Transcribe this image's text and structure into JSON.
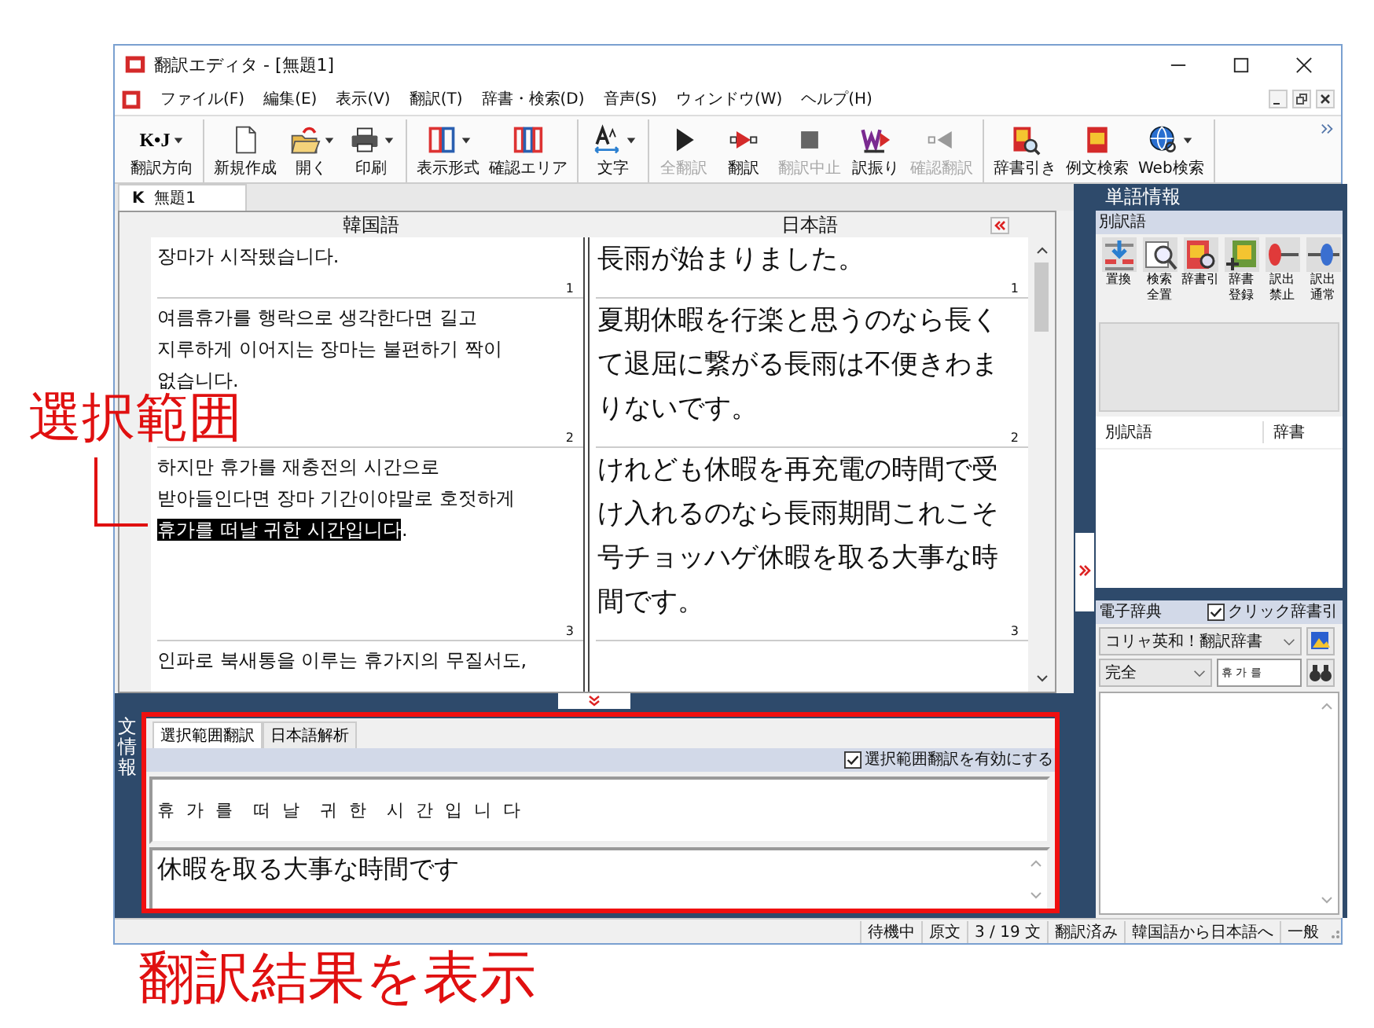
{
  "window": {
    "title": "翻訳エディタ - [無題1]"
  },
  "menu": [
    "ファイル(F)",
    "編集(E)",
    "表示(V)",
    "翻訳(T)",
    "辞書・検索(D)",
    "音声(S)",
    "ウィンドウ(W)",
    "ヘルプ(H)"
  ],
  "toolbar": [
    {
      "items": [
        {
          "kind": "direction",
          "glyph": "K•J",
          "label": "翻訳方向",
          "dropdown": true,
          "disabled": false
        }
      ]
    },
    {
      "items": [
        {
          "kind": "new",
          "label": "新規作成",
          "dropdown": false,
          "disabled": false
        },
        {
          "kind": "open",
          "label": "開く",
          "dropdown": true,
          "disabled": false
        },
        {
          "kind": "print",
          "label": "印刷",
          "dropdown": true,
          "disabled": false
        }
      ]
    },
    {
      "items": [
        {
          "kind": "layout",
          "label": "表示形式",
          "dropdown": true,
          "disabled": false
        },
        {
          "kind": "confirm_area",
          "label": "確認エリア",
          "dropdown": false,
          "disabled": false
        }
      ]
    },
    {
      "items": [
        {
          "kind": "font",
          "label": "文字",
          "dropdown": true,
          "disabled": false
        }
      ]
    },
    {
      "items": [
        {
          "kind": "translate_all",
          "label": "全翻訳",
          "dropdown": false,
          "disabled": true
        },
        {
          "kind": "translate",
          "label": "翻訳",
          "dropdown": false,
          "disabled": false
        },
        {
          "kind": "stop",
          "label": "翻訳中止",
          "dropdown": false,
          "disabled": true
        },
        {
          "kind": "word",
          "label": "訳振り",
          "dropdown": false,
          "disabled": false
        },
        {
          "kind": "check",
          "label": "確認翻訳",
          "dropdown": false,
          "disabled": true
        }
      ]
    },
    {
      "items": [
        {
          "kind": "dict",
          "label": "辞書引き",
          "dropdown": false,
          "disabled": false
        },
        {
          "kind": "example",
          "label": "例文検索",
          "dropdown": false,
          "disabled": false
        },
        {
          "kind": "web",
          "label": "Web検索",
          "dropdown": true,
          "disabled": false
        }
      ]
    }
  ],
  "document_tab": {
    "glyph": "K",
    "label": "無題1"
  },
  "editor": {
    "source_heading": "韓国語",
    "target_heading": "日本語",
    "segments": [
      {
        "source_number": "1",
        "target_number": "1",
        "source_lines": [
          [
            {
              "text": "장마가 시작됐습니다.",
              "selected": false
            }
          ]
        ],
        "target": "長雨が始まりました。"
      },
      {
        "source_number": "2",
        "target_number": "2",
        "source_lines": [
          [
            {
              "text": "여름휴가를 행락으로 생각한다면 길고",
              "selected": false
            }
          ],
          [
            {
              "text": "지루하게 이어지는 장마는 불편하기 짝이",
              "selected": false
            }
          ],
          [
            {
              "text": "없습니다.",
              "selected": false
            }
          ]
        ],
        "target": "夏期休暇を行楽と思うのなら長くて退屈に繋がる長雨は不便きわまりないです。"
      },
      {
        "source_number": "3",
        "target_number": "3",
        "source_lines": [
          [
            {
              "text": "하지만 휴가를 재충전의 시간으로",
              "selected": false
            }
          ],
          [
            {
              "text": "받아들인다면 장마 기간이야말로 호젓하게",
              "selected": false
            }
          ],
          [
            {
              "text": "휴가를 떠날 귀한 시간입니다",
              "selected": true
            },
            {
              "text": ".",
              "selected": false
            }
          ]
        ],
        "target": "けれども休暇を再充電の時間で受け入れるのなら長雨期間これこそ号チョッハゲ休暇を取る大事な時間です。"
      },
      {
        "source_lines": [
          [
            {
              "text": "인파로 북새통을 이루는 휴가지의 무질서도,",
              "selected": false
            }
          ]
        ]
      }
    ]
  },
  "sentence_panel": {
    "side_label": "文情報",
    "tabs": [
      {
        "label": "選択範囲翻訳",
        "selected": true
      },
      {
        "label": "日本語解析",
        "selected": false
      }
    ],
    "enable_option": {
      "label": "選択範囲翻訳を有効にする",
      "checked": true
    },
    "source": "휴 가 를  떠 날  귀 한  시 간 입 니 다",
    "result": "休暇を取る大事な時間です"
  },
  "word_info": {
    "title": "単語情報",
    "section": "別訳語",
    "tools": [
      {
        "kind": "replace",
        "label_lines": [
          "置換"
        ]
      },
      {
        "kind": "search_all",
        "label_lines": [
          "検索",
          "全置"
        ]
      },
      {
        "kind": "lookup",
        "label_lines": [
          "辞書引"
        ]
      },
      {
        "kind": "register",
        "label_lines": [
          "辞書",
          "登録"
        ]
      },
      {
        "kind": "block",
        "label_lines": [
          "訳出",
          "禁止"
        ]
      },
      {
        "kind": "normal",
        "label_lines": [
          "訳出",
          "通常"
        ]
      }
    ],
    "columns": [
      "別訳語",
      "辞書"
    ]
  },
  "e_dictionary": {
    "title": "電子辞典",
    "click_lookup": {
      "label": "クリック辞書引",
      "checked": true
    },
    "dictionary": "コリャ英和！翻訳辞書",
    "match": "完全",
    "query": "휴 가 를"
  },
  "status_bar": [
    "待機中",
    "原文",
    "3 / 19 文",
    "翻訳済み",
    "韓国語から日本語へ",
    "一般"
  ],
  "annotations": {
    "selection_label": "選択範囲",
    "result_label": "翻訳結果を表示"
  }
}
